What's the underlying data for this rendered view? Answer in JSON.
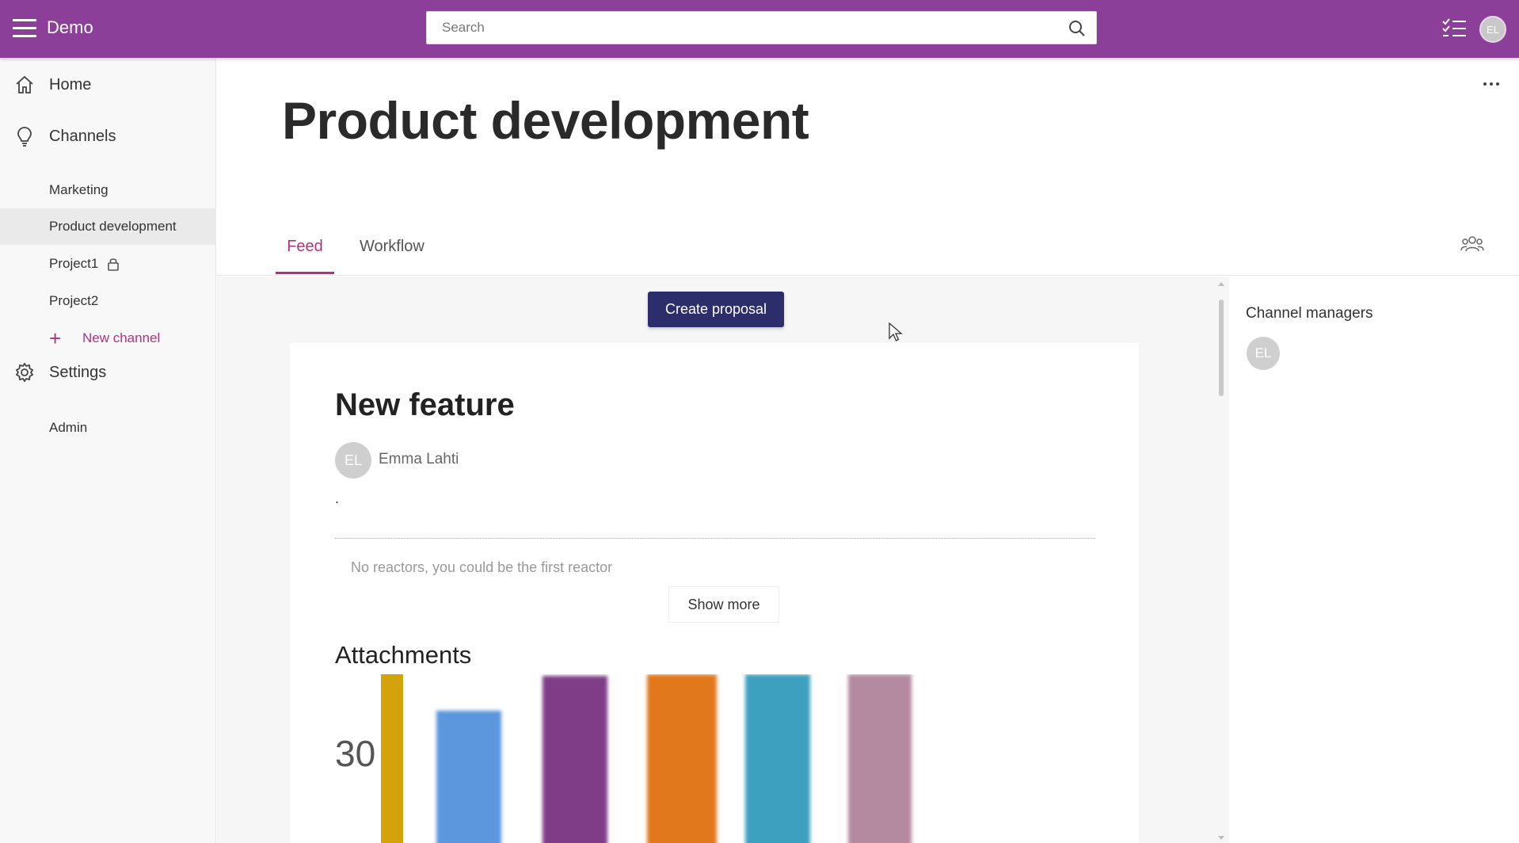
{
  "topbar": {
    "app_title": "Demo",
    "search_placeholder": "Search",
    "avatar_initials": "EL",
    "background_color": "#8c3f99"
  },
  "sidebar": {
    "home": "Home",
    "channels": "Channels",
    "channel_items": [
      "Marketing",
      "Product development",
      "Project1",
      "Project2"
    ],
    "new_channel": "New channel",
    "settings": "Settings",
    "admin": "Admin"
  },
  "main": {
    "title": "Product development",
    "tabs": [
      {
        "label": "Feed",
        "active": true
      },
      {
        "label": "Workflow",
        "active": false
      }
    ]
  },
  "feed": {
    "create_button": "Create proposal",
    "post": {
      "title": "New feature",
      "author_initials": "EL",
      "author": "Emma Lahti",
      "body": ".",
      "reactors_text": "No reactors, you could be the first reactor",
      "show_more": "Show more",
      "attachments_title": "Attachments"
    }
  },
  "right_panel": {
    "managers_title": "Channel managers",
    "manager_initials": "EL"
  },
  "chart_data": {
    "type": "bar",
    "title": "",
    "tick_labels": [
      "30"
    ],
    "colors": [
      "#d4a20a",
      "#5b96dc",
      "#7e3d86",
      "#e2781a",
      "#3da0bf",
      "#b48aa0"
    ]
  },
  "colors": {
    "accent": "#b3307e",
    "primary_button": "#2c2d6b"
  }
}
